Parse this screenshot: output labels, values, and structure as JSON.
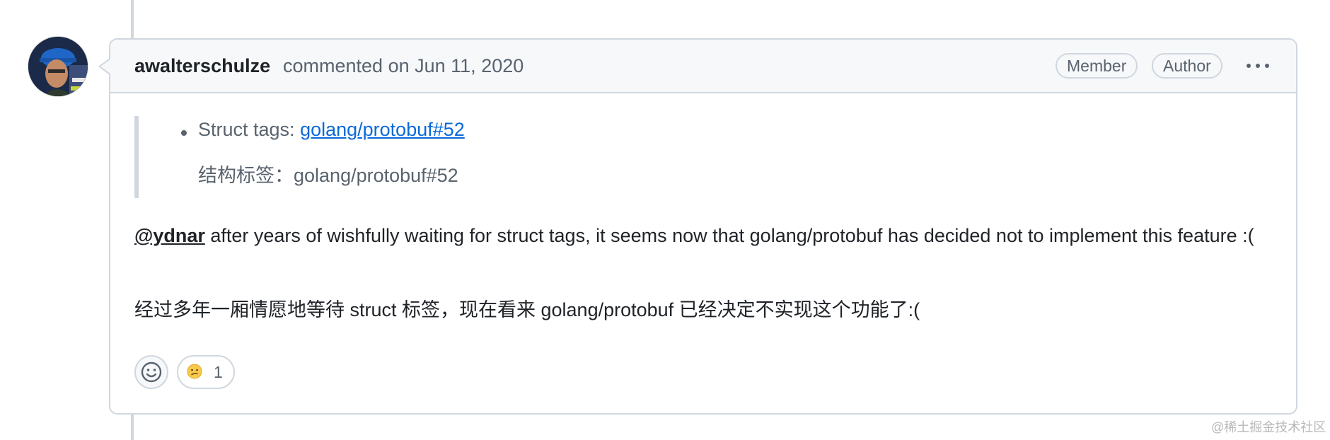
{
  "comment": {
    "author": "awalterschulze",
    "action": "commented on",
    "date": "Jun 11, 2020",
    "badges": [
      "Member",
      "Author"
    ],
    "quote": {
      "bullet_label": "Struct tags:",
      "link_text": "golang/protobuf#52",
      "translation": "结构标签：golang/protobuf#52"
    },
    "body": {
      "mention": "@ydnar",
      "text": " after years of wishfully waiting for struct tags, it seems now that golang/protobuf has decided not to implement this feature :(",
      "translation": "经过多年一厢情愿地等待 struct 标签，现在看来 golang/protobuf 已经决定不实现这个功能了:("
    },
    "reactions": [
      {
        "emoji": "confused-face-icon",
        "count": "1"
      }
    ]
  },
  "watermark": "@稀土掘金技术社区"
}
